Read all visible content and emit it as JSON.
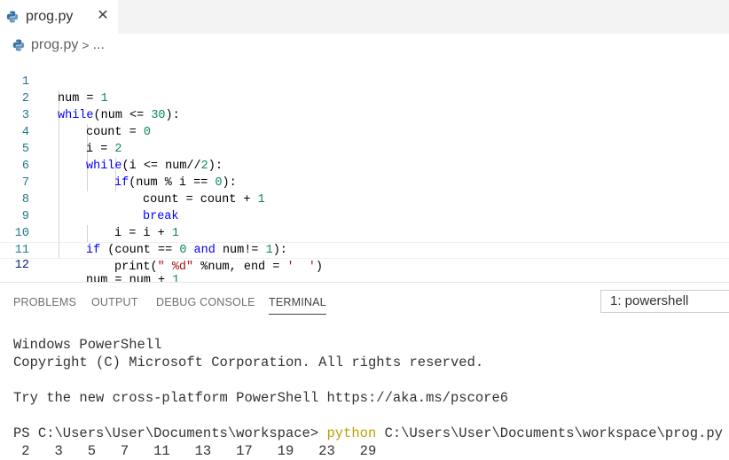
{
  "tab": {
    "label": "prog.py",
    "close_glyph": "✕",
    "icon": "python-icon"
  },
  "breadcrumb": {
    "file": "prog.py",
    "separator": ">",
    "more": "..."
  },
  "editor": {
    "lines": [
      {
        "n": "1"
      },
      {
        "n": "2"
      },
      {
        "n": "3"
      },
      {
        "n": "4"
      },
      {
        "n": "5"
      },
      {
        "n": "6"
      },
      {
        "n": "7"
      },
      {
        "n": "8"
      },
      {
        "n": "9"
      },
      {
        "n": "10"
      },
      {
        "n": "11"
      },
      {
        "n": "12"
      }
    ],
    "code": {
      "l1": {
        "a": "num = ",
        "b": "1"
      },
      "l2": {
        "kw": "while",
        "a": "(num <= ",
        "b": "30",
        "c": "):"
      },
      "l3": {
        "a": "count = ",
        "b": "0"
      },
      "l4": {
        "a": "i = ",
        "b": "2"
      },
      "l5": {
        "kw": "while",
        "a": "(i <= num//",
        "b": "2",
        "c": "):"
      },
      "l6": {
        "kw": "if",
        "a": "(num % i == ",
        "b": "0",
        "c": "):"
      },
      "l7": {
        "a": "count = count + ",
        "b": "1"
      },
      "l8": {
        "kw": "break"
      },
      "l9": {
        "a": "i = i + ",
        "b": "1"
      },
      "l10": {
        "kw": "if",
        "a": " (count == ",
        "b": "0",
        "kw2": "and",
        "c": " num!= ",
        "d": "1",
        "e": "):"
      },
      "l11": {
        "fn": "print",
        "a": "(",
        "s1": "\" %d\"",
        "b": " %num, end = ",
        "s2": "'  '",
        "c": ")"
      },
      "l12": {
        "a": "num = num + ",
        "b": "1"
      }
    }
  },
  "panel": {
    "tabs": [
      "PROBLEMS",
      "OUTPUT",
      "DEBUG CONSOLE",
      "TERMINAL"
    ],
    "active_tab": "TERMINAL",
    "terminal_select": "1: powershell"
  },
  "terminal": {
    "line1": "Windows PowerShell",
    "line2": "Copyright (C) Microsoft Corporation. All rights reserved.",
    "line3": "Try the new cross-platform PowerShell https://aka.ms/pscore6",
    "prompt": "PS C:\\Users\\User\\Documents\\workspace> ",
    "cmd": "python",
    "cmd_args": " C:\\Users\\User\\Documents\\workspace\\prog.py",
    "output": " 2   3   5   7   11   13   17   19   23   29"
  },
  "colors": {
    "keyword": "#0000ff",
    "number": "#09885a",
    "string": "#a31515",
    "line_number": "#237893",
    "command": "#b5a300"
  }
}
